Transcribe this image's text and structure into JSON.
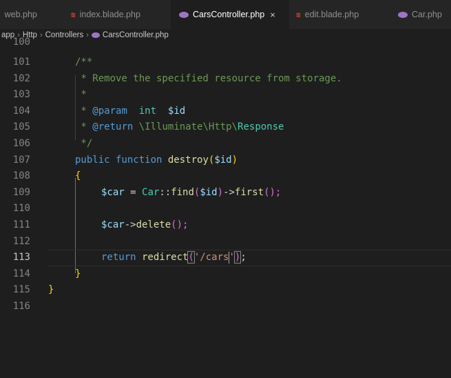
{
  "tabs": [
    {
      "label": "web.php",
      "icon": "php-elephant-icon",
      "active": false
    },
    {
      "label": "index.blade.php",
      "icon": "blade-icon",
      "active": false
    },
    {
      "label": "CarsController.php",
      "icon": "php-elephant-icon",
      "active": true,
      "close": "×"
    },
    {
      "label": "edit.blade.php",
      "icon": "blade-icon",
      "active": false
    },
    {
      "label": "Car.php",
      "icon": "php-elephant-icon",
      "active": false
    }
  ],
  "breadcrumb": [
    "app",
    "Http",
    "Controllers",
    "CarsController.php"
  ],
  "lines": [
    {
      "n": "100"
    },
    {
      "n": "101"
    },
    {
      "n": "102"
    },
    {
      "n": "103"
    },
    {
      "n": "104"
    },
    {
      "n": "105"
    },
    {
      "n": "106"
    },
    {
      "n": "107"
    },
    {
      "n": "108"
    },
    {
      "n": "109"
    },
    {
      "n": "110"
    },
    {
      "n": "111"
    },
    {
      "n": "112"
    },
    {
      "n": "113"
    },
    {
      "n": "114"
    },
    {
      "n": "115"
    },
    {
      "n": "116"
    }
  ],
  "code": {
    "l101": "/**",
    "l102": " * Remove the specified resource from storage.",
    "l103": " *",
    "l104a": " * ",
    "l104b": "@param",
    "l104c": "  int  ",
    "l104d": "$id",
    "l105a": " * ",
    "l105b": "@return",
    "l105c": " \\Illuminate\\Http\\",
    "l105d": "Response",
    "l106": " */",
    "l107a": "public",
    "l107b": " function ",
    "l107c": "destroy",
    "l107d": "(",
    "l107e": "$id",
    "l107f": ")",
    "l108": "{",
    "l109a": "$car",
    "l109b": " = ",
    "l109c": "Car",
    "l109d": "::",
    "l109e": "find",
    "l109f": "(",
    "l109g": "$id",
    "l109h": ")",
    "l109i": "->",
    "l109j": "first",
    "l109k": "();",
    "l111a": "$car",
    "l111b": "->",
    "l111c": "delete",
    "l111d": "();",
    "l113a": "return",
    "l113b": " redirect",
    "l113c": "(",
    "l113d": "'/cars",
    "l113e": "'",
    "l113f": ")",
    "l113g": ";",
    "l114": "}",
    "l115": "}"
  },
  "colors": {
    "background": "#1e1e1e",
    "tabbar": "#252526",
    "comment": "#6a9955",
    "keyword": "#569cd6",
    "function": "#dcdcaa",
    "variable": "#9cdcfe",
    "class": "#4ec9b0",
    "string": "#ce9178"
  }
}
